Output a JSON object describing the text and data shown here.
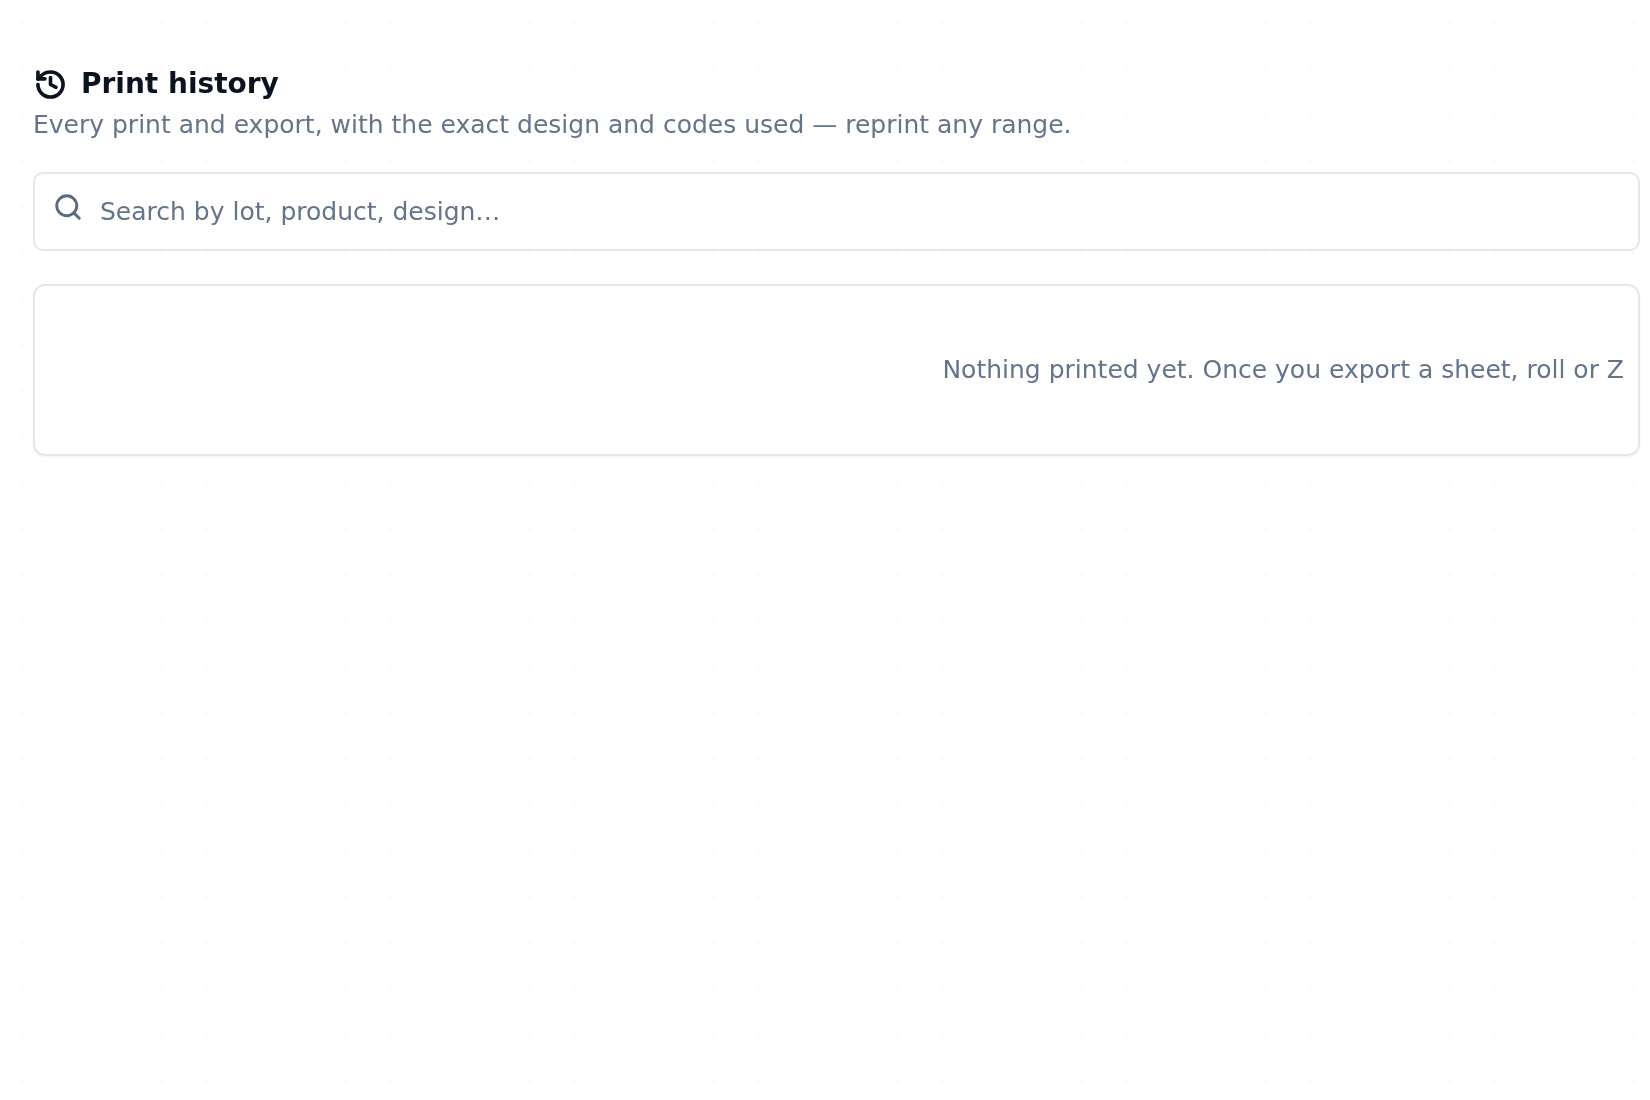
{
  "header": {
    "title": "Print history",
    "subtitle": "Every print and export, with the exact design and codes used — reprint any range."
  },
  "search": {
    "placeholder": "Search by lot, product, design…"
  },
  "history": {
    "empty_message": "Nothing printed yet. Once you export a sheet, roll or Z"
  }
}
